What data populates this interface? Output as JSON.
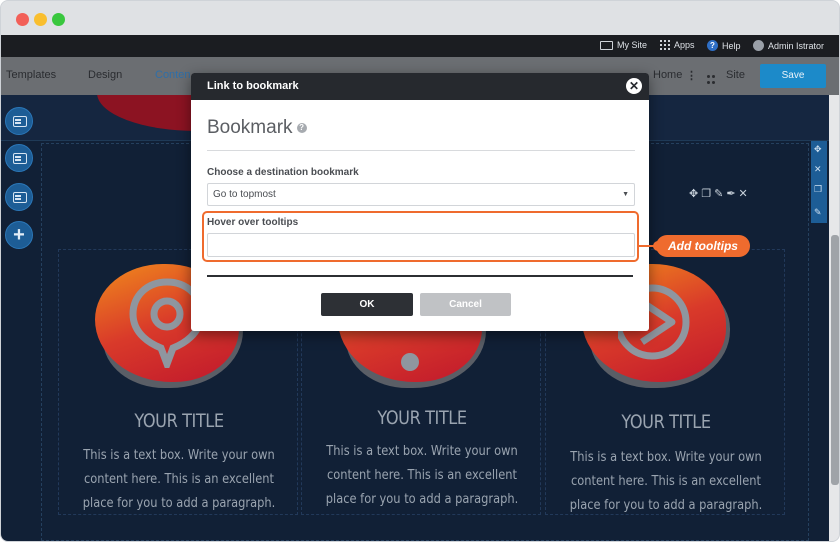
{
  "topbar": {
    "my_site": "My Site",
    "apps": "Apps",
    "help": "Help",
    "user": "Admin Istrator"
  },
  "toolbar": {
    "templates": "Templates",
    "design": "Design",
    "content": "Conten",
    "home": "Home",
    "site": "Site",
    "save": "Save"
  },
  "modal": {
    "title": "Link to bookmark",
    "heading": "Bookmark",
    "destination_label": "Choose a destination bookmark",
    "destination_value": "Go to topmost",
    "tooltip_label": "Hover over tooltips",
    "tooltip_value": "",
    "ok_label": "OK",
    "cancel_label": "Cancel"
  },
  "callout": {
    "text": "Add tooltips",
    "color": "#ef6b2e"
  },
  "columns": [
    {
      "title": "YOUR TITLE",
      "text": "This is a text box. Write your own content here. This is an excellent place for you to add a paragraph.",
      "icon": "location-pin-icon"
    },
    {
      "title": "YOUR TITLE",
      "text": "This is a text box. Write your own content here. This is an excellent place for you to add a paragraph.",
      "icon": "exclamation-icon"
    },
    {
      "title": "YOUR TITLE",
      "text": "This is a text box. Write your own content here. This is an excellent place for you to add a paragraph.",
      "icon": "play-icon"
    }
  ],
  "colors": {
    "accent": "#1c8ac9",
    "canvas_bg": "#112036",
    "modal_header": "#26292e"
  }
}
